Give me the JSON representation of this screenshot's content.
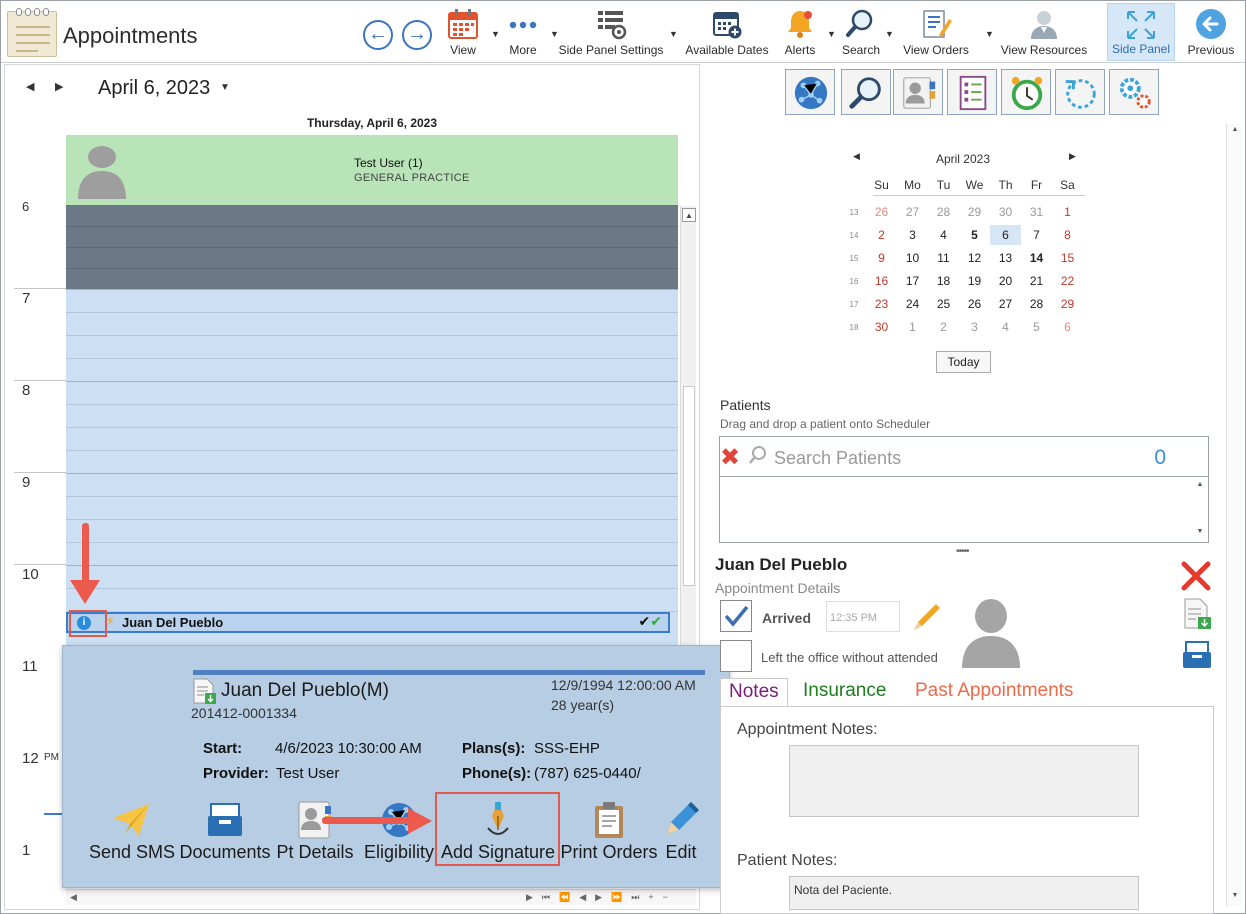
{
  "toolbar": {
    "title": "Appointments",
    "buttons": {
      "view": "View",
      "more": "More",
      "side_panel_settings": "Side Panel Settings",
      "available_dates": "Available Dates",
      "alerts": "Alerts",
      "search": "Search",
      "view_orders": "View Orders",
      "view_resources": "View Resources",
      "side_panel": "Side Panel",
      "previous": "Previous"
    }
  },
  "scheduler": {
    "date_title": "April 6, 2023",
    "day_header": "Thursday, April 6, 2023",
    "resource_name": "Test User (1)",
    "resource_dept": "GENERAL PRACTICE",
    "hours": [
      "6",
      "7",
      "8",
      "9",
      "10",
      "11",
      "12",
      "1"
    ],
    "pm_label": "PM",
    "appointment_name": "Juan Del Pueblo",
    "info_icon_glyph": "i"
  },
  "popup": {
    "name": "Juan Del Pueblo(M)",
    "id": "201412-0001334",
    "dob": "12/9/1994 12:00:00 AM",
    "age": "28 year(s)",
    "start_label": "Start:",
    "start_value": "4/6/2023 10:30:00 AM",
    "provider_label": "Provider:",
    "provider_value": "Test User",
    "plans_label": "Plans(s):",
    "plans_value": "SSS-EHP",
    "phones_label": "Phone(s):",
    "phones_value": "(787) 625-0440/",
    "actions": {
      "send_sms": "Send SMS",
      "documents": "Documents",
      "pt_details": "Pt Details",
      "eligibility": "Eligibility",
      "add_signature": "Add Signature",
      "print_orders": "Print Orders",
      "edit": "Edit"
    }
  },
  "mini_calendar": {
    "title": "April 2023",
    "weekdays": [
      "Su",
      "Mo",
      "Tu",
      "We",
      "Th",
      "Fr",
      "Sa"
    ],
    "weeks": [
      {
        "wk": "13",
        "days": [
          "26",
          "27",
          "28",
          "29",
          "30",
          "31",
          "1"
        ]
      },
      {
        "wk": "14",
        "days": [
          "2",
          "3",
          "4",
          "5",
          "6",
          "7",
          "8"
        ]
      },
      {
        "wk": "15",
        "days": [
          "9",
          "10",
          "11",
          "12",
          "13",
          "14",
          "15"
        ]
      },
      {
        "wk": "16",
        "days": [
          "16",
          "17",
          "18",
          "19",
          "20",
          "21",
          "22"
        ]
      },
      {
        "wk": "17",
        "days": [
          "23",
          "24",
          "25",
          "26",
          "27",
          "28",
          "29"
        ]
      },
      {
        "wk": "18",
        "days": [
          "30",
          "1",
          "2",
          "3",
          "4",
          "5",
          "6"
        ]
      }
    ],
    "today_label": "Today"
  },
  "patients": {
    "title": "Patients",
    "subtitle": "Drag and drop a patient onto Scheduler",
    "search_placeholder": "Search Patients",
    "count": "0"
  },
  "details": {
    "name": "Juan Del Pueblo",
    "subtitle": "Appointment Details",
    "arrived_label": "Arrived",
    "arrived_time": "12:35 PM",
    "left_office_label": "Left the office without attended",
    "tabs": {
      "notes": "Notes",
      "insurance": "Insurance",
      "past": "Past Appointments"
    },
    "appointment_notes_label": "Appointment Notes:",
    "patient_notes_label": "Patient Notes:",
    "patient_notes_value": "Nota del Paciente."
  },
  "colors": {
    "accent_blue": "#3b74c0",
    "resource_green": "#b9e4b8",
    "slot_blue": "#cddff3",
    "highlight_red": "#e05a4e"
  }
}
